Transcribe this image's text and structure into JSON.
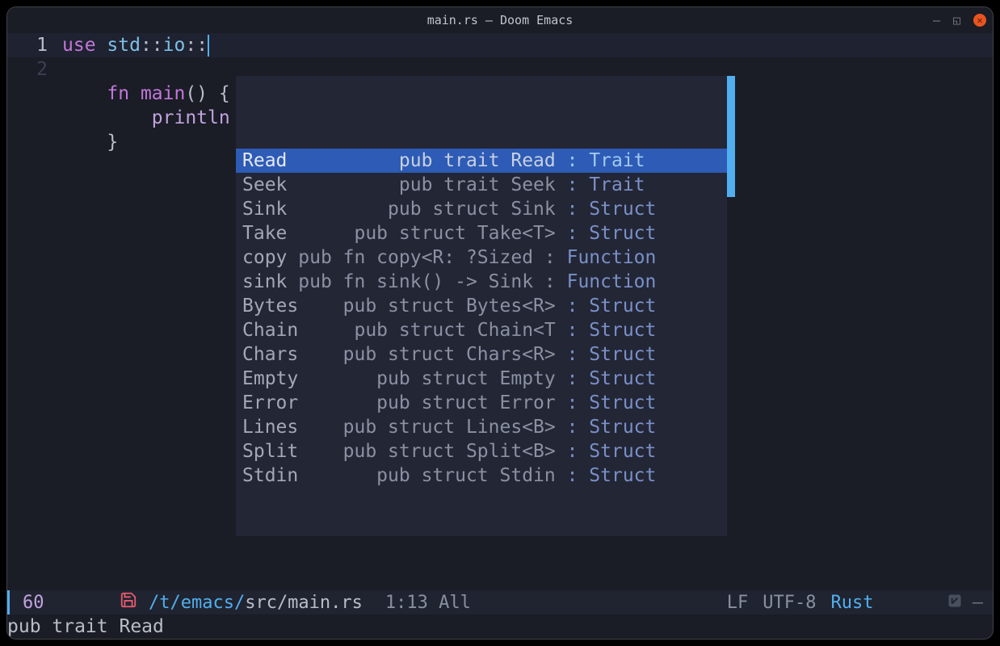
{
  "titlebar": {
    "title": "main.rs – Doom Emacs"
  },
  "code": {
    "line1_num": "1",
    "line1_use": "use ",
    "line1_std": "std",
    "line1_sep1": "::",
    "line1_io": "io",
    "line1_sep2": "::",
    "line2_num": "2",
    "line3_indent": "    ",
    "line3_fn": "fn ",
    "line3_main": "main",
    "line3_rest": "() {",
    "line4_indent": "        ",
    "line4_println": "println",
    "line5_indent": "    ",
    "line5_brace": "}"
  },
  "completions": [
    {
      "name": "Read ",
      "sig": "         pub trait Read ",
      "kind": ": Trait "
    },
    {
      "name": "Seek ",
      "sig": "         pub trait Seek ",
      "kind": ": Trait "
    },
    {
      "name": "Sink ",
      "sig": "        pub struct Sink ",
      "kind": ": Struct"
    },
    {
      "name": "Take ",
      "sig": "     pub struct Take<T> ",
      "kind": ": Struct"
    },
    {
      "name": "copy ",
      "sig": "pub fn copy<R: ?Sized : ",
      "kind": "Function"
    },
    {
      "name": "sink ",
      "sig": "pub fn sink() -> Sink : ",
      "kind": "Function"
    },
    {
      "name": "Bytes",
      "sig": "    pub struct Bytes<R> ",
      "kind": ": Struct"
    },
    {
      "name": "Chain",
      "sig": "     pub struct Chain<T ",
      "kind": ": Struct"
    },
    {
      "name": "Chars",
      "sig": "    pub struct Chars<R> ",
      "kind": ": Struct"
    },
    {
      "name": "Empty",
      "sig": "       pub struct Empty ",
      "kind": ": Struct"
    },
    {
      "name": "Error",
      "sig": "       pub struct Error ",
      "kind": ": Struct"
    },
    {
      "name": "Lines",
      "sig": "    pub struct Lines<B> ",
      "kind": ": Struct"
    },
    {
      "name": "Split",
      "sig": "    pub struct Split<B> ",
      "kind": ": Struct"
    },
    {
      "name": "Stdin",
      "sig": "       pub struct Stdin ",
      "kind": ": Struct"
    }
  ],
  "modeline": {
    "percent": "60",
    "path_dim": "/t/emacs/",
    "path_bright": "src/main.rs",
    "position": "1:13 All",
    "line_ending": "LF",
    "encoding": "UTF-8",
    "language": "Rust",
    "dash": "–"
  },
  "echo": {
    "text": "pub trait Read"
  }
}
